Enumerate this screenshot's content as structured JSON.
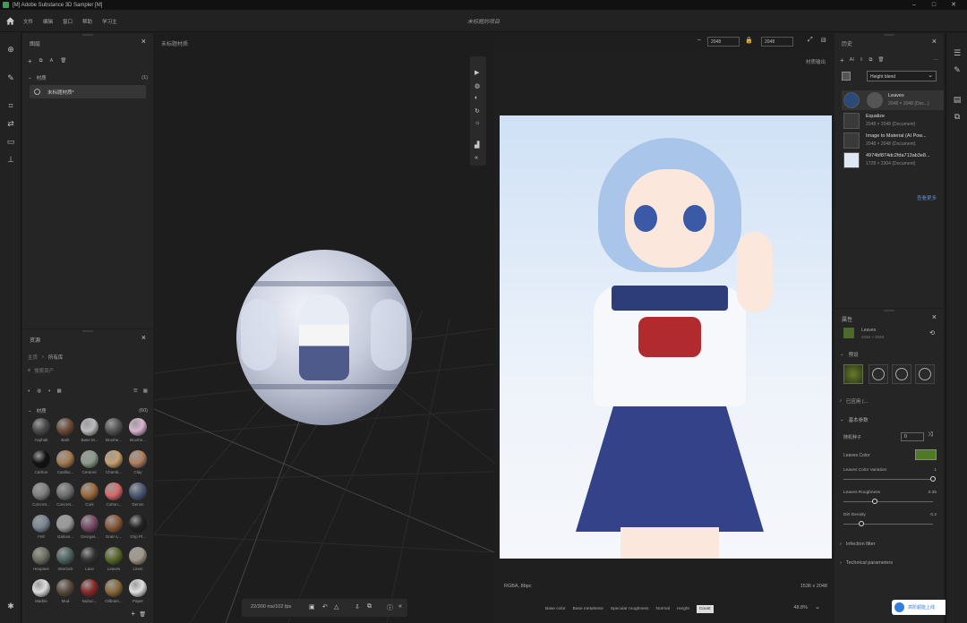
{
  "titlebar": {
    "title": "[M] Adobe Substance 3D Sampler [M]"
  },
  "menubar": {
    "items": [
      "文件",
      "编辑",
      "窗口",
      "帮助",
      "学习主"
    ],
    "document": "未标题的项目"
  },
  "layers": {
    "title": "图层",
    "group": "材质",
    "group_count": "(1)",
    "item": "未标题材质*"
  },
  "assets": {
    "title": "资源",
    "breadcrumb_root": "主页",
    "breadcrumb_current": "所有库",
    "search_placeholder": "搜索资产",
    "section": "材质",
    "section_count": "(60)",
    "items": [
      {
        "label": "Asphalt",
        "color": "#4a4a4a"
      },
      {
        "label": "Bark",
        "color": "#6b4a35"
      },
      {
        "label": "Base M...",
        "color": "#bbbbbb"
      },
      {
        "label": "Brushe...",
        "color": "#555555"
      },
      {
        "label": "Brushe...",
        "color": "#d9b3cf"
      },
      {
        "label": "Carbon",
        "color": "#111111"
      },
      {
        "label": "Cardbo...",
        "color": "#a67c52"
      },
      {
        "label": "Ceramic",
        "color": "#8c9c8a"
      },
      {
        "label": "Chamb...",
        "color": "#c9a070"
      },
      {
        "label": "Clay",
        "color": "#b08060"
      },
      {
        "label": "Concret...",
        "color": "#808080"
      },
      {
        "label": "Concret...",
        "color": "#707070"
      },
      {
        "label": "Cork",
        "color": "#9c6b3c"
      },
      {
        "label": "Cotton...",
        "color": "#d86a6a"
      },
      {
        "label": "Denim",
        "color": "#4c5a78"
      },
      {
        "label": "Felt",
        "color": "#7a8694"
      },
      {
        "label": "Galvan...",
        "color": "#999999"
      },
      {
        "label": "Georget...",
        "color": "#7a4a66"
      },
      {
        "label": "Grain L...",
        "color": "#8a5a3a"
      },
      {
        "label": "Grip Pl...",
        "color": "#222222"
      },
      {
        "label": "Hexpave",
        "color": "#6c7060"
      },
      {
        "label": "Interlock",
        "color": "#4c6660"
      },
      {
        "label": "Lace",
        "color": "#333333"
      },
      {
        "label": "Leaves",
        "color": "#5a6a2a"
      },
      {
        "label": "Linen",
        "color": "#a09888"
      },
      {
        "label": "Marble",
        "color": "#dddddd"
      },
      {
        "label": "Mud",
        "color": "#5a4a3a"
      },
      {
        "label": "Nubuc...",
        "color": "#8a2a2a"
      },
      {
        "label": "Oilbrain...",
        "color": "#8a6a3a"
      },
      {
        "label": "Paper",
        "color": "#e0e0e0"
      }
    ]
  },
  "viewport3d": {
    "title": "未标题材质",
    "status": "22/300 ms/102 fps"
  },
  "viewport2d": {
    "resolution_w": "2048",
    "resolution_h": "2048",
    "output_label": "材质输出",
    "channel": "RGBA, 8bpc",
    "size": "1536 x 2048",
    "zoom": "48.8%",
    "tabs": [
      "Base color",
      "Base metalness",
      "Specular roughness",
      "Normal",
      "Height",
      "Count"
    ]
  },
  "history": {
    "title": "历史",
    "blend": "Height blend",
    "items": [
      {
        "name": "Leaves",
        "dims": "2048 × 2048 (Doc...)"
      },
      {
        "name": "Equalize",
        "dims": "2048 × 2048 (Document)"
      },
      {
        "name": "Image to Material (AI Pow...",
        "dims": "2048 × 2048 (Document)"
      },
      {
        "name": "4974bf874dc2fda713ab3e8...",
        "dims": "1728 × 2304 (Document)"
      }
    ],
    "link": "查看更多"
  },
  "properties": {
    "title": "属性",
    "layer_name": "Leaves",
    "layer_dims": "2048 × 2048",
    "section_preset": "预设",
    "section_adv": "已应用 (...",
    "section_params": "基本参数",
    "seed_label": "随机种子",
    "seed_value": "0",
    "color_label": "Leaves Color",
    "color": "#4e7a23",
    "variation_label": "Leaves Color Variation",
    "variation_value": "1",
    "variation_fraction": 1.0,
    "rough_label": "Leaves Roughness",
    "rough_value": "0.35",
    "rough_fraction": 0.35,
    "density_label": "Dirt Density",
    "density_value": "0.2",
    "density_fraction": 0.2,
    "section_infection": "Infection filter",
    "section_tech": "Technical parameters",
    "badge": "高阶超能上线"
  }
}
